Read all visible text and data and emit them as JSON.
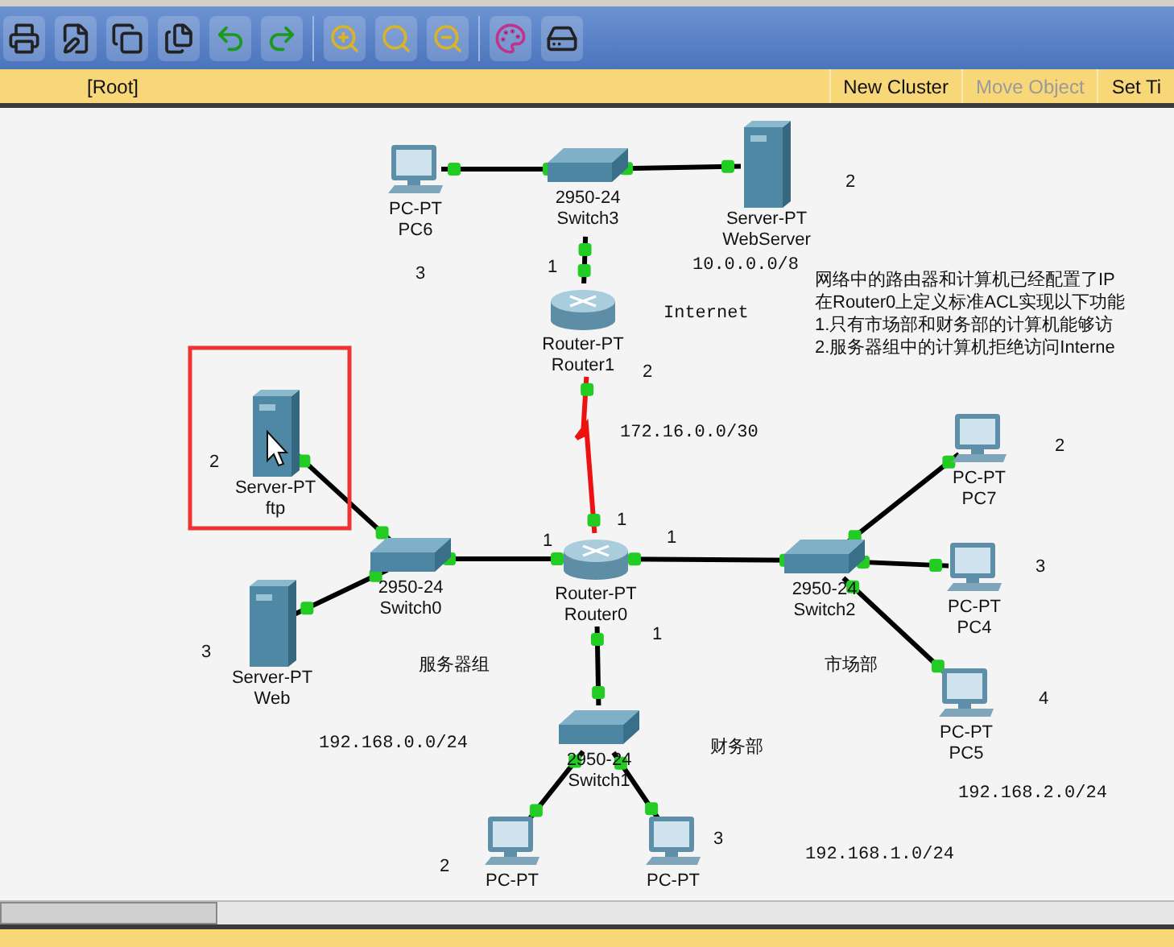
{
  "breadcrumb": {
    "path": "[Root]",
    "actions": [
      {
        "label": "New Cluster",
        "disabled": false
      },
      {
        "label": "Move Object",
        "disabled": true
      },
      {
        "label": "Set Ti",
        "disabled": false
      }
    ]
  },
  "devices": [
    {
      "kind": "pc",
      "model": "PC-PT",
      "name": "PC6",
      "highlighted": false
    },
    {
      "kind": "switch",
      "model": "2950-24",
      "name": "Switch3",
      "highlighted": false
    },
    {
      "kind": "server",
      "model": "Server-PT",
      "name": "WebServer",
      "highlighted": false
    },
    {
      "kind": "router",
      "model": "Router-PT",
      "name": "Router1",
      "highlighted": false
    },
    {
      "kind": "server",
      "model": "Server-PT",
      "name": "ftp",
      "highlighted": true
    },
    {
      "kind": "switch",
      "model": "2950-24",
      "name": "Switch0",
      "highlighted": false
    },
    {
      "kind": "server",
      "model": "Server-PT",
      "name": "Web",
      "highlighted": false
    },
    {
      "kind": "router",
      "model": "Router-PT",
      "name": "Router0",
      "highlighted": false
    },
    {
      "kind": "switch",
      "model": "2950-24",
      "name": "Switch2",
      "highlighted": false
    },
    {
      "kind": "pc",
      "model": "PC-PT",
      "name": "PC7",
      "highlighted": false
    },
    {
      "kind": "pc",
      "model": "PC-PT",
      "name": "PC4",
      "highlighted": false
    },
    {
      "kind": "pc",
      "model": "PC-PT",
      "name": "PC5",
      "highlighted": false
    },
    {
      "kind": "switch",
      "model": "2950-24",
      "name": "Switch1",
      "highlighted": false
    },
    {
      "kind": "pc",
      "model": "PC-PT",
      "highlighted": false
    },
    {
      "kind": "pc",
      "model": "PC-PT",
      "highlighted": false
    }
  ],
  "annotations": [
    "2",
    "3",
    "1",
    "10.0.0.0/8",
    "Internet",
    "2",
    "172.16.0.0/30",
    "2",
    "2",
    "1",
    "1",
    "1",
    "3",
    "1",
    "3",
    "服务器组",
    "市场部",
    "4",
    "192.168.0.0/24",
    "财务部",
    "192.168.2.0/24",
    "3",
    "192.168.1.0/24",
    "2"
  ],
  "note": [
    "网络中的路由器和计算机已经配置了IP",
    "在Router0上定义标准ACL实现以下功能",
    "1.只有市场部和财务部的计算机能够访",
    "2.服务器组中的计算机拒绝访问Interne"
  ]
}
